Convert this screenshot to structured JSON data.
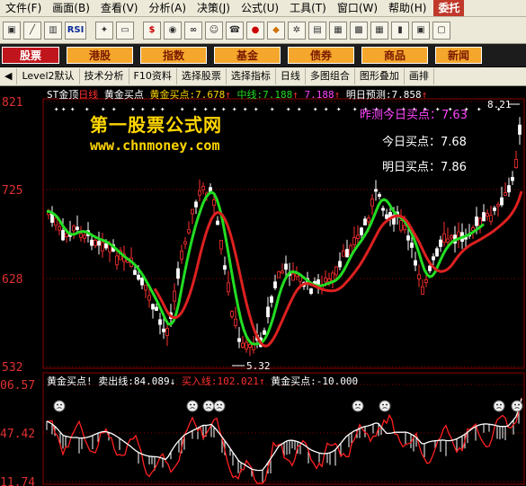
{
  "menu": [
    "文件(F)",
    "画面(B)",
    "查看(V)",
    "分析(A)",
    "决策(J)",
    "公式(U)",
    "工具(T)",
    "窗口(W)",
    "帮助(H)"
  ],
  "menu_active": "委托",
  "toolbar_icons": [
    "monitor-icon",
    "chart-icon",
    "bar-icon",
    "rsi-icon",
    "compass-icon",
    "ruler-icon",
    "dollar-icon",
    "eye-icon",
    "binoculars-icon",
    "people-icon",
    "phone-icon",
    "dot-icon",
    "diamond-icon",
    "gear-icon",
    "book-icon",
    "book2-icon",
    "calc-icon",
    "table-icon",
    "bars-icon",
    "monitor2-icon",
    "tv-icon"
  ],
  "toolbar_rsi": "RSI",
  "tabs": [
    "股票",
    "港股",
    "指数",
    "基金",
    "债券",
    "商品",
    "新闻"
  ],
  "funcbar": [
    "◀",
    "Level2默认",
    "技术分析",
    "F10资料",
    "选择股票",
    "选择指标",
    "日线",
    "多图组合",
    "图形叠加",
    "画排"
  ],
  "main_header": {
    "title": "ST金顶",
    "period": "日线",
    "ind1_label": "黄金买点",
    "ind2_label": "黄金买点:",
    "ind2_value": "7.678",
    "mid_label": "中线:",
    "mid_value": "7.188",
    "mid2_value": "7.188",
    "predict_label": "明日预测:",
    "predict_value": "7.858"
  },
  "y_axis_main": [
    "821",
    "725",
    "628",
    "532"
  ],
  "y_axis_sub": [
    "06.57",
    "47.42",
    "11.74"
  ],
  "watermark": {
    "line1": "第一股票公式网",
    "line2": "www.chnmoney.com"
  },
  "annotations": {
    "yesterday": "昨测今日买点：7.63",
    "today": "今日买点：7.68",
    "tomorrow": "明日买点：7.86",
    "high_value": "8.21",
    "low_value": "5.32"
  },
  "sub_header": {
    "label1": "黄金买点!",
    "sell_label": "卖出线:",
    "sell_value": "84.089",
    "buy_label": "买入线:",
    "buy_value": "102.021",
    "gold_label": "黄金买点:",
    "gold_value": "-10.000"
  },
  "colors": {
    "up": "#ff3030",
    "down": "#ffffff",
    "ma_green": "#22dd22",
    "ma_red": "#dd2020",
    "grid": "#8b0000",
    "axis_text": "#e03030",
    "magenta": "#ff44ff",
    "yellow": "#ffd600"
  }
}
